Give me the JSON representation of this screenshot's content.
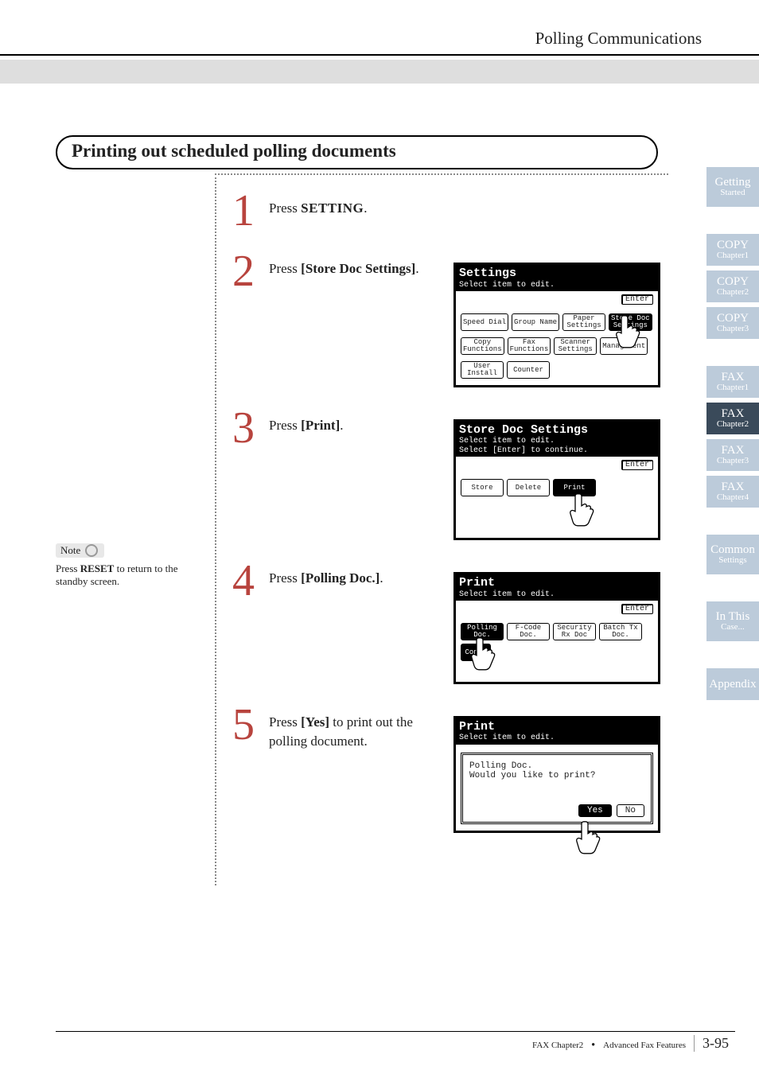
{
  "header": {
    "breadcrumb": "Polling Communications"
  },
  "section": {
    "title": "Printing out scheduled polling documents"
  },
  "steps": {
    "s1": {
      "num": "1",
      "pre": "Press ",
      "key": "SETTING",
      "post": "."
    },
    "s2": {
      "num": "2",
      "pre": "Press ",
      "bold": "[Store Doc Settings]",
      "post": "."
    },
    "s3": {
      "num": "3",
      "pre": "Press ",
      "bold": "[Print]",
      "post": "."
    },
    "s4": {
      "num": "4",
      "pre": "Press ",
      "bold": "[Polling Doc.]",
      "post": "."
    },
    "s5": {
      "num": "5",
      "pre": "Press ",
      "bold": "[Yes]",
      "post": " to print out the polling document."
    }
  },
  "note": {
    "label": "Note",
    "body_pre": "Press ",
    "body_key": "RESET",
    "body_post": " to return to the standby screen."
  },
  "lcd": {
    "enter": "Enter",
    "settings": {
      "title": "Settings",
      "sub": "Select item to edit.",
      "btns": {
        "speed_dial": "Speed Dial",
        "group_name": "Group Name",
        "paper_settings": "Paper\nSettings",
        "store_doc_settings": "Store Doc\nSettings",
        "copy_functions": "Copy\nFunctions",
        "fax_functions": "Fax\nFunctions",
        "scanner_settings": "Scanner\nSettings",
        "management": "Management",
        "user_install": "User\nInstall",
        "counter": "Counter"
      }
    },
    "store_doc": {
      "title": "Store Doc Settings",
      "sub1": "Select item to edit.",
      "sub2": "Select [Enter] to continue.",
      "btns": {
        "store": "Store",
        "delete": "Delete",
        "print": "Print"
      }
    },
    "print": {
      "title": "Print",
      "sub": "Select item to edit.",
      "btns": {
        "polling_doc": "Polling\nDoc.",
        "fcode_doc": "F-Code\nDoc.",
        "security_rx": "Security\nRx Doc",
        "batch_tx": "Batch Tx\nDoc.",
        "cont": "Cont."
      }
    },
    "confirm": {
      "title": "Print",
      "sub": "Select item to edit.",
      "line1": "Polling Doc.",
      "line2": "Would you like to print?",
      "yes": "Yes",
      "no": "No"
    }
  },
  "tabs": [
    {
      "t": "Getting",
      "s": "Started",
      "state": "light",
      "tall": true
    },
    {
      "gap": true
    },
    {
      "t": "COPY",
      "s": "Chapter1",
      "state": "light"
    },
    {
      "t": "COPY",
      "s": "Chapter2",
      "state": "light"
    },
    {
      "t": "COPY",
      "s": "Chapter3",
      "state": "light"
    },
    {
      "gap": true
    },
    {
      "t": "FAX",
      "s": "Chapter1",
      "state": "light"
    },
    {
      "t": "FAX",
      "s": "Chapter2",
      "state": "active"
    },
    {
      "t": "FAX",
      "s": "Chapter3",
      "state": "light"
    },
    {
      "t": "FAX",
      "s": "Chapter4",
      "state": "light"
    },
    {
      "gap": true
    },
    {
      "t": "Common",
      "s": "Settings",
      "state": "light",
      "tall": true
    },
    {
      "gap": true
    },
    {
      "t": "In This",
      "s": "Case...",
      "state": "light",
      "tall": true
    },
    {
      "gap": true
    },
    {
      "t": "Appendix",
      "s": "",
      "state": "light"
    }
  ],
  "footer": {
    "left": "FAX Chapter2",
    "right": "Advanced Fax Features",
    "page": "3-95"
  }
}
